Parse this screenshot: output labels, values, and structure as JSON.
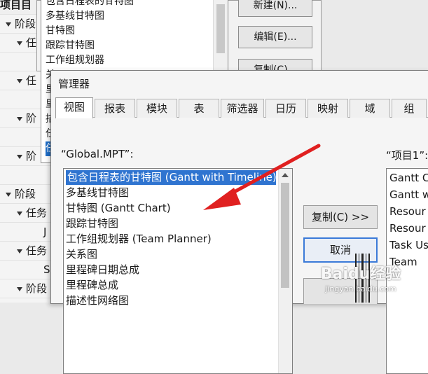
{
  "outline": {
    "rows": [
      {
        "label": "项目目",
        "indent": 0,
        "header": true,
        "tri": false
      },
      {
        "label": "阶段",
        "indent": 8,
        "header": false,
        "tri": true
      },
      {
        "label": "任",
        "indent": 24,
        "header": false,
        "tri": true
      },
      {
        "label": "",
        "indent": 24,
        "header": false,
        "tri": false
      },
      {
        "label": "任",
        "indent": 24,
        "header": false,
        "tri": true
      },
      {
        "label": "",
        "indent": 24,
        "header": false,
        "tri": false
      },
      {
        "label": "阶",
        "indent": 24,
        "header": false,
        "tri": true
      },
      {
        "label": "",
        "indent": 24,
        "header": false,
        "tri": false
      },
      {
        "label": "阶",
        "indent": 24,
        "header": false,
        "tri": true
      },
      {
        "label": "",
        "indent": 24,
        "header": false,
        "tri": false
      },
      {
        "label": "阶段",
        "indent": 8,
        "header": false,
        "tri": true
      },
      {
        "label": "任务",
        "indent": 24,
        "header": false,
        "tri": true
      },
      {
        "label": "J",
        "indent": 62,
        "header": false,
        "tri": false
      },
      {
        "label": "任务",
        "indent": 24,
        "header": false,
        "tri": true
      },
      {
        "label": "S",
        "indent": 62,
        "header": false,
        "tri": false
      },
      {
        "label": "阶段",
        "indent": 24,
        "header": false,
        "tri": true
      }
    ]
  },
  "bg_dialog": {
    "items": [
      {
        "label": "包含日程表的甘特图",
        "selected": false
      },
      {
        "label": "多基线甘特图",
        "selected": false
      },
      {
        "label": "甘特图",
        "selected": false
      },
      {
        "label": "跟踪甘特图",
        "selected": false
      },
      {
        "label": "工作组规划器",
        "selected": false
      },
      {
        "label": "关",
        "selected": false
      },
      {
        "label": "里",
        "selected": false
      },
      {
        "label": "里",
        "selected": false
      },
      {
        "label": "描",
        "selected": false
      },
      {
        "label": "任",
        "selected": false
      },
      {
        "label": "任",
        "selected": true
      }
    ],
    "buttons": [
      "新建(N)...",
      "编辑(E)...",
      "复制(C)..."
    ]
  },
  "dialog": {
    "title": "管理器",
    "tabs": [
      "视图",
      "报表",
      "模块",
      "表",
      "筛选器",
      "日历",
      "映射",
      "域",
      "组",
      ""
    ],
    "active_tab": 0,
    "left_caption": "“Global.MPT”:",
    "right_caption": "“项目1”:",
    "left_items": [
      {
        "label": "包含日程表的甘特图 (Gantt with Timeline)",
        "selected": true
      },
      {
        "label": "多基线甘特图",
        "selected": false
      },
      {
        "label": "甘特图 (Gantt Chart)",
        "selected": false
      },
      {
        "label": "跟踪甘特图",
        "selected": false
      },
      {
        "label": "工作组规划器 (Team Planner)",
        "selected": false
      },
      {
        "label": "关系图",
        "selected": false
      },
      {
        "label": "里程碑日期总成",
        "selected": false
      },
      {
        "label": "里程碑总成",
        "selected": false
      },
      {
        "label": "描述性网络图",
        "selected": false
      }
    ],
    "right_items": [
      "Gantt C",
      "Gantt w",
      "Resour",
      "Resour",
      "Task Us",
      "Team"
    ],
    "copy_button": "复制(C) >>",
    "cancel_button": "取消"
  },
  "watermark": {
    "brand": "Baidu经验",
    "url": "jingyan.baidu.com"
  },
  "colors": {
    "selection": "#2f74d0",
    "arrow": "#e02020"
  }
}
